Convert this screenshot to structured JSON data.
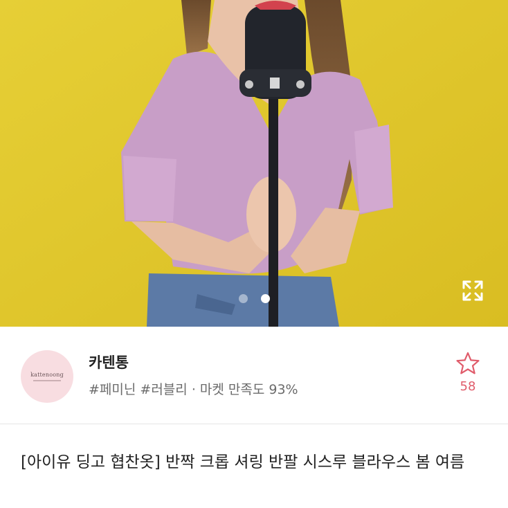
{
  "gallery": {
    "slide_count": 2,
    "active_slide": 2,
    "background_color": "#e2c92d",
    "expand_icon": "expand-arrows-icon"
  },
  "seller": {
    "avatar_text": "kattenoong",
    "name": "카텐통",
    "tags": "#페미닌 #러블리",
    "separator": "·",
    "satisfaction": "마켓 만족도 93%",
    "favorite_icon": "star-outline-icon",
    "favorite_count": "58",
    "accent_color": "#e05c6b"
  },
  "product": {
    "title": "[아이유 딩고 협찬옷] 반짝 크롭 셔링 반팔 시스루 블라우스 봄 여름"
  }
}
